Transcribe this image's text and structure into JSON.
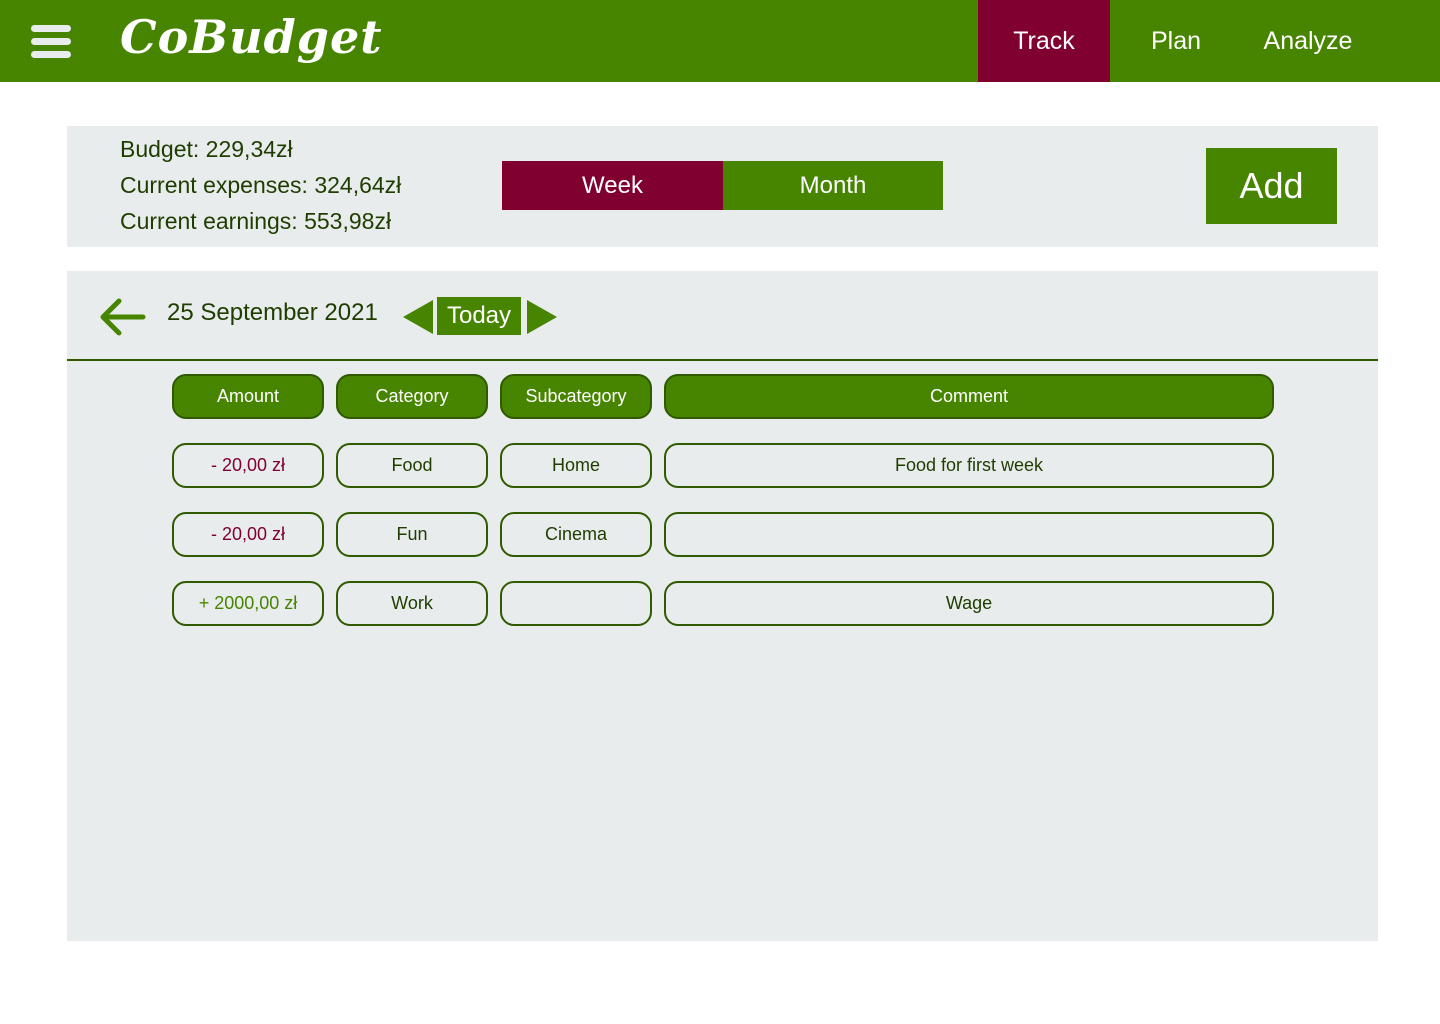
{
  "header": {
    "menu_icon": "hamburger-menu-icon",
    "logo": "CoBudget",
    "nav": [
      {
        "label": "Track",
        "active": true
      },
      {
        "label": "Plan",
        "active": false
      },
      {
        "label": "Analyze",
        "active": false
      }
    ]
  },
  "summary": {
    "budget": "Budget: 229,34zł",
    "expenses": "Current expenses: 324,64zł",
    "earnings": "Current earnings: 553,98zł",
    "period_toggle": {
      "week": "Week",
      "month": "Month",
      "selected": "Week"
    },
    "add_label": "Add"
  },
  "day_view": {
    "back_icon": "arrow-left-icon",
    "date": "25 September 2021",
    "prev_icon": "triangle-left-icon",
    "today_label": "Today",
    "next_icon": "triangle-right-icon"
  },
  "table": {
    "headers": [
      "Amount",
      "Category",
      "Subcategory",
      "Comment"
    ],
    "rows": [
      {
        "amount": "- 20,00 zł",
        "category": "Food",
        "subcategory": "Home",
        "comment": "Food for first week"
      },
      {
        "amount": "- 20,00 zł",
        "category": "Fun",
        "subcategory": "Cinema",
        "comment": ""
      },
      {
        "amount": "+ 2000,00 zł",
        "category": "Work",
        "subcategory": "",
        "comment": "Wage"
      }
    ]
  },
  "colors": {
    "primary_green": "#478500",
    "accent_maroon": "#800030",
    "panel_gray": "#e8ecec",
    "dark_green_text": "#1f3d00"
  }
}
